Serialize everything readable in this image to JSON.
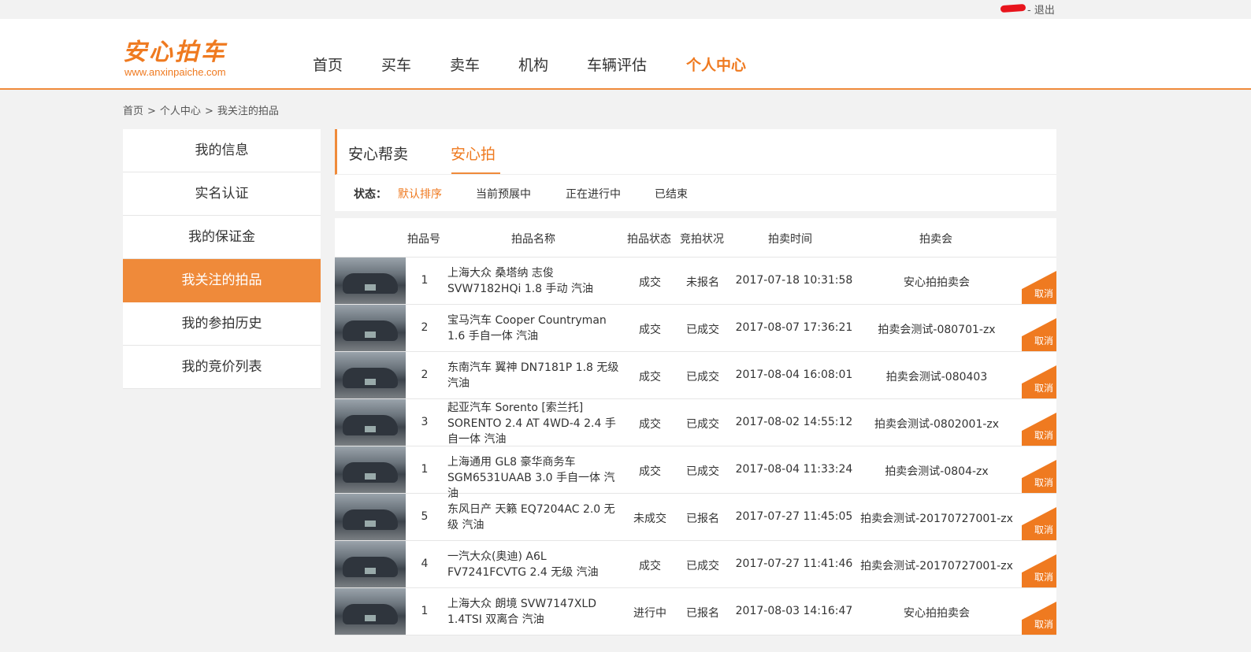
{
  "topbar": {
    "logout": "- 退出"
  },
  "logo": {
    "cn": "安心拍车",
    "en": "www.anxinpaiche.com"
  },
  "nav": [
    "首页",
    "买车",
    "卖车",
    "机构",
    "车辆评估",
    "个人中心"
  ],
  "breadcrumb": [
    "首页",
    "个人中心",
    "我关注的拍品"
  ],
  "sidebar": [
    "我的信息",
    "实名认证",
    "我的保证金",
    "我关注的拍品",
    "我的参拍历史",
    "我的竞价列表"
  ],
  "tabs": [
    "安心帮卖",
    "安心拍"
  ],
  "status": {
    "label": "状态：",
    "options": [
      "默认排序",
      "当前预展中",
      "正在进行中",
      "已结束"
    ]
  },
  "table": {
    "headers": [
      "拍品号",
      "拍品名称",
      "拍品状态",
      "竞拍状况",
      "拍卖时间",
      "拍卖会"
    ],
    "cancel_label": "取消",
    "rows": [
      {
        "no": "1",
        "name": "上海大众 桑塔纳 志俊 SVW7182HQi 1.8 手动 汽油",
        "status": "成交",
        "bid": "未报名",
        "time": "2017-07-18 10:31:58",
        "auction": "安心拍拍卖会"
      },
      {
        "no": "2",
        "name": "宝马汽车 Cooper Countryman 1.6 手自一体 汽油",
        "status": "成交",
        "bid": "已成交",
        "time": "2017-08-07 17:36:21",
        "auction": "拍卖会测试-080701-zx"
      },
      {
        "no": "2",
        "name": "东南汽车 翼神 DN7181P 1.8 无级 汽油",
        "status": "成交",
        "bid": "已成交",
        "time": "2017-08-04 16:08:01",
        "auction": "拍卖会测试-080403"
      },
      {
        "no": "3",
        "name": "起亚汽车 Sorento [索兰托] SORENTO 2.4 AT 4WD-4 2.4 手自一体 汽油",
        "status": "成交",
        "bid": "已成交",
        "time": "2017-08-02 14:55:12",
        "auction": "拍卖会测试-0802001-zx"
      },
      {
        "no": "1",
        "name": "上海通用 GL8 豪华商务车 SGM6531UAAB 3.0 手自一体 汽油",
        "status": "成交",
        "bid": "已成交",
        "time": "2017-08-04 11:33:24",
        "auction": "拍卖会测试-0804-zx"
      },
      {
        "no": "5",
        "name": "东风日产 天籁 EQ7204AC 2.0 无级 汽油",
        "status": "未成交",
        "bid": "已报名",
        "time": "2017-07-27 11:45:05",
        "auction": "拍卖会测试-20170727001-zx"
      },
      {
        "no": "4",
        "name": "一汽大众(奥迪) A6L FV7241FCVTG 2.4 无级 汽油",
        "status": "成交",
        "bid": "已成交",
        "time": "2017-07-27 11:41:46",
        "auction": "拍卖会测试-20170727001-zx"
      },
      {
        "no": "1",
        "name": "上海大众 朗境 SVW7147XLD 1.4TSI 双离合 汽油",
        "status": "进行中",
        "bid": "已报名",
        "time": "2017-08-03 14:16:47",
        "auction": "安心拍拍卖会"
      }
    ]
  }
}
